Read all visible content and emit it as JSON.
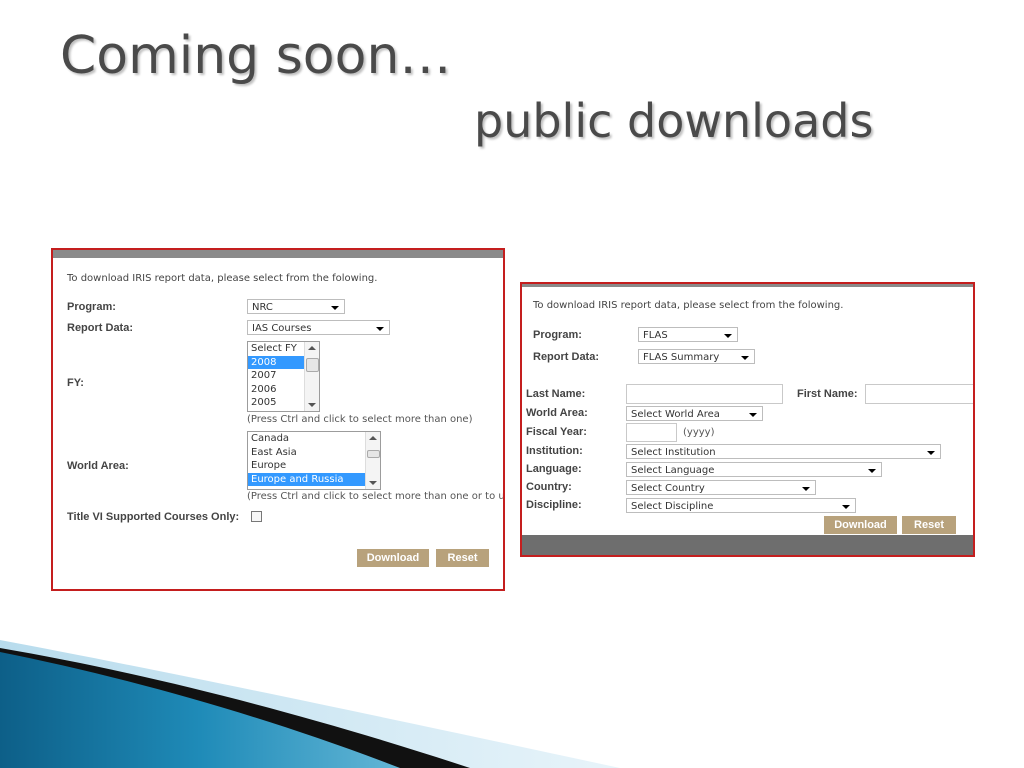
{
  "slide": {
    "title_line1": "Coming soon…",
    "title_line2": "public downloads"
  },
  "form1": {
    "intro": "To download IRIS report data, please select from the folowing.",
    "program_label": "Program:",
    "program_value": "NRC",
    "report_label": "Report Data:",
    "report_value": "IAS Courses",
    "fy_label": "FY:",
    "fy_options": [
      "Select FY",
      "2008",
      "2007",
      "2006",
      "2005"
    ],
    "fy_selected": "2008",
    "fy_hint": "(Press Ctrl and click to select more than one)",
    "area_label": "World Area:",
    "area_options": [
      "Canada",
      "East Asia",
      "Europe",
      "Europe and Russia"
    ],
    "area_selected": "Europe and Russia",
    "area_hint": "(Press Ctrl and click to select more than one or to unse",
    "title6_label": "Title VI Supported Courses Only:",
    "download_label": "Download",
    "reset_label": "Reset"
  },
  "form2": {
    "intro": "To download IRIS report data, please select from the folowing.",
    "program_label": "Program:",
    "program_value": "FLAS",
    "report_label": "Report Data:",
    "report_value": "FLAS Summary",
    "lastname_label": "Last Name:",
    "firstname_label": "First Name:",
    "area_label": "World Area:",
    "area_value": "Select World Area",
    "fiscal_label": "Fiscal Year:",
    "fiscal_hint": "(yyyy)",
    "institution_label": "Institution:",
    "institution_value": "Select Institution",
    "language_label": "Language:",
    "language_value": "Select Language",
    "country_label": "Country:",
    "country_value": "Select Country",
    "discipline_label": "Discipline:",
    "discipline_value": "Select Discipline",
    "download_label": "Download",
    "reset_label": "Reset"
  },
  "colors": {
    "panel_border": "#c41e1e",
    "button": "#b8a27c",
    "list_selection": "#3399ff",
    "title_text": "#4a4a4a"
  }
}
